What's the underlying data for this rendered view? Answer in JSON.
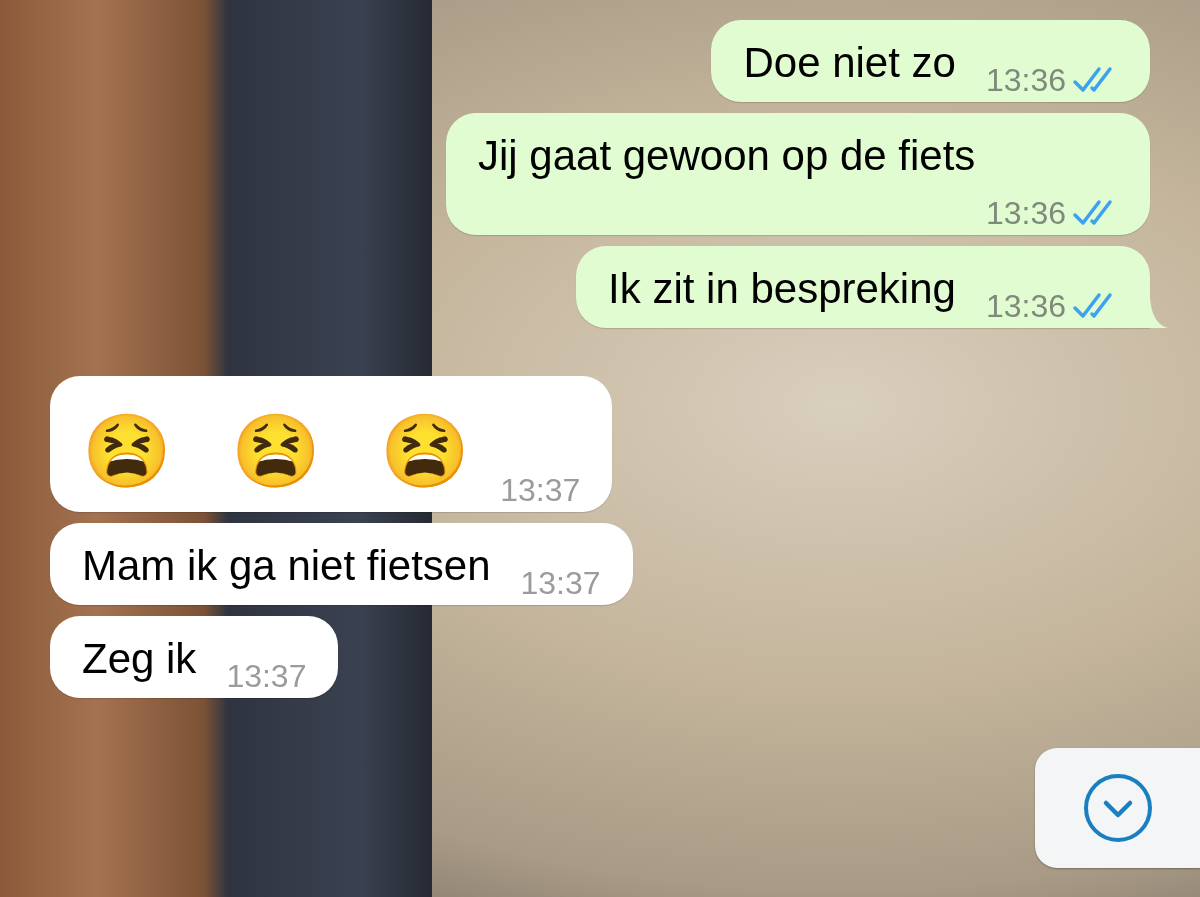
{
  "messages": [
    {
      "kind": "text",
      "outgoing": true,
      "text": "Doe niet zo",
      "time": "13:36",
      "read": true,
      "tail": false
    },
    {
      "kind": "text",
      "outgoing": true,
      "text": "Jij gaat gewoon op de fiets",
      "time": "13:36",
      "read": true,
      "tail": false
    },
    {
      "kind": "text",
      "outgoing": true,
      "text": "Ik zit in bespreking",
      "time": "13:36",
      "read": true,
      "tail": true
    },
    {
      "kind": "emoji",
      "outgoing": false,
      "text": "😫 😫 😫",
      "time": "13:37",
      "tail": false
    },
    {
      "kind": "text",
      "outgoing": false,
      "text": "Mam ik ga niet fietsen",
      "time": "13:37",
      "tail": false
    },
    {
      "kind": "text",
      "outgoing": false,
      "text": "Zeg ik",
      "time": "13:37",
      "tail": false
    }
  ]
}
